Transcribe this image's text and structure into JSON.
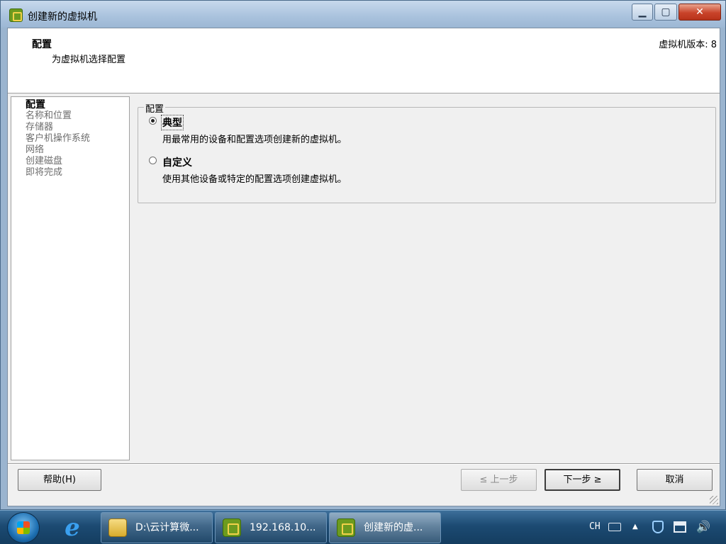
{
  "window": {
    "title": "创建新的虚拟机"
  },
  "header": {
    "title": "配置",
    "subtitle": "为虚拟机选择配置",
    "version": "虚拟机版本: 8"
  },
  "nav": {
    "items": [
      {
        "label": "配置",
        "active": true
      },
      {
        "label": "名称和位置",
        "active": false
      },
      {
        "label": "存储器",
        "active": false
      },
      {
        "label": "客户机操作系统",
        "active": false
      },
      {
        "label": "网络",
        "active": false
      },
      {
        "label": "创建磁盘",
        "active": false
      },
      {
        "label": "即将完成",
        "active": false
      }
    ]
  },
  "config_group": {
    "legend": "配置",
    "options": [
      {
        "label": "典型",
        "description": "用最常用的设备和配置选项创建新的虚拟机。",
        "selected": true
      },
      {
        "label": "自定义",
        "description": "使用其他设备或特定的配置选项创建虚拟机。",
        "selected": false
      }
    ]
  },
  "buttons": {
    "help": "帮助(H)",
    "back": "≤ 上一步",
    "next": "下一步 ≥",
    "cancel": "取消"
  },
  "taskbar": {
    "tasks": [
      {
        "label": "D:\\云计算微...",
        "icon": "folder-icon"
      },
      {
        "label": "192.168.10...",
        "icon": "vsphere-icon"
      },
      {
        "label": "创建新的虚...",
        "icon": "vsphere-icon",
        "active": true
      }
    ],
    "tray": {
      "language": "CH"
    }
  }
}
